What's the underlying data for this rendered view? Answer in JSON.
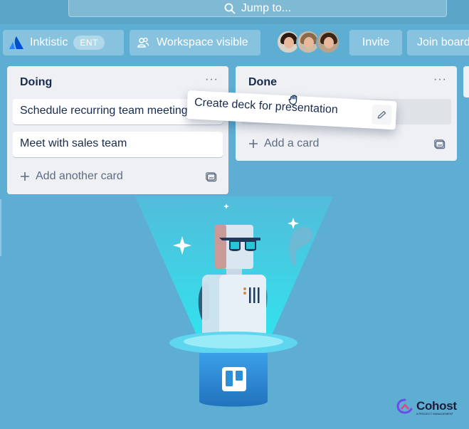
{
  "topbar": {
    "search_label": "Jump to..."
  },
  "boardbar": {
    "workspace_name": "Inktistic",
    "workspace_badge": "ENT",
    "visibility_label": "Workspace visible",
    "invite_label": "Invite",
    "join_label": "Join board",
    "avatars": [
      {
        "hair": "#2b1a12",
        "bg": "#d9d2c7"
      },
      {
        "hair": "#8a6a4a",
        "bg": "#c9bda9"
      },
      {
        "hair": "#3a2416",
        "bg": "#b8a48c"
      }
    ]
  },
  "lists": {
    "doing": {
      "title": "Doing",
      "menu": "···",
      "cards": [
        "Schedule recurring team meetings",
        "Meet with sales team"
      ],
      "add_label": "Add another card"
    },
    "done": {
      "title": "Done",
      "menu": "···",
      "add_label": "Add a card"
    }
  },
  "drag_card": {
    "title": "Create deck for presentation"
  },
  "brand": {
    "name": "Cohost",
    "tagline": "A PROJECT MANAGEMENT"
  },
  "colors": {
    "board_bg": "#5eaed3",
    "beam": "#2dd4e6",
    "hat": "#2b8fd6",
    "robot_body": "#dbe7f0",
    "glasses": "#1f3a5a"
  }
}
